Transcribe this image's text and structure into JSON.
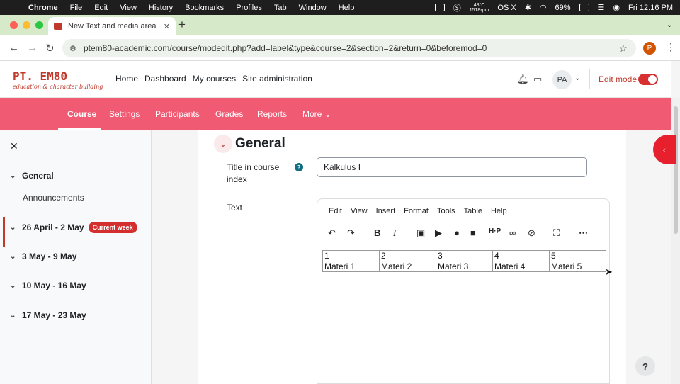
{
  "macos": {
    "app": "Chrome",
    "menus": [
      "File",
      "Edit",
      "View",
      "History",
      "Bookmarks",
      "Profiles",
      "Tab",
      "Window",
      "Help"
    ],
    "temp": "48°C",
    "rpm": "1518rpm",
    "os": "OS X",
    "battery": "69%",
    "clock": "Fri 12.16 PM"
  },
  "browser": {
    "tab_title": "New Text and media area | Ma",
    "url": "ptem80-academic.com/course/modedit.php?add=label&type&course=2&section=2&return=0&beforemod=0",
    "profile_initial": "P"
  },
  "site": {
    "logo_text": "PT. EM80",
    "logo_tagline": "education & character building",
    "primary_nav": [
      "Home",
      "Dashboard",
      "My courses",
      "Site administration"
    ],
    "user_initials": "PA",
    "edit_mode_label": "Edit mode",
    "edit_mode_on": true
  },
  "course_nav": {
    "items": [
      "Course",
      "Settings",
      "Participants",
      "Grades",
      "Reports",
      "More"
    ],
    "active": "Course",
    "color": "#f05a72"
  },
  "course_index": {
    "sections": [
      {
        "title": "General",
        "items": [
          "Announcements"
        ]
      },
      {
        "title": "26 April - 2 May",
        "badge": "Current week"
      },
      {
        "title": "3 May - 9 May"
      },
      {
        "title": "10 May - 16 May"
      },
      {
        "title": "17 May - 23 May"
      }
    ]
  },
  "form": {
    "section_heading": "General",
    "title_label": "Title in course index",
    "title_value": "Kalkulus I",
    "text_label": "Text",
    "editor_menus": [
      "Edit",
      "View",
      "Insert",
      "Format",
      "Tools",
      "Table",
      "Help"
    ],
    "table": [
      [
        "1",
        "2",
        "3",
        "4",
        "5"
      ],
      [
        "Materi 1",
        "Materi 2",
        "Materi 3",
        "Materi 4",
        "Materi 5"
      ]
    ]
  }
}
